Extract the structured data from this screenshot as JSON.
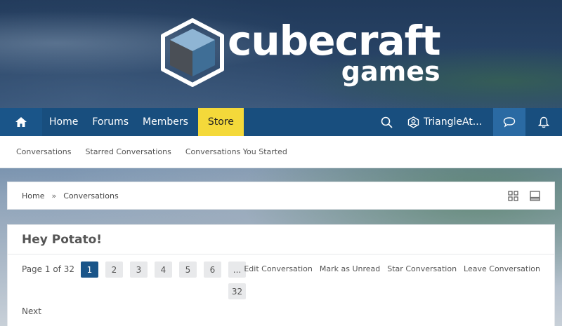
{
  "branding": {
    "logo_main": "cubecraft",
    "logo_sub": "games"
  },
  "nav": {
    "items": [
      {
        "label": "Home"
      },
      {
        "label": "Forums"
      },
      {
        "label": "Members"
      },
      {
        "label": "Store"
      }
    ],
    "username": "TriangleAt...",
    "colors": {
      "bar": "#184e7e",
      "store": "#f4d93a",
      "active_tab": "#2a6aa3"
    }
  },
  "subnav": {
    "items": [
      {
        "label": "Conversations"
      },
      {
        "label": "Starred Conversations"
      },
      {
        "label": "Conversations You Started"
      }
    ]
  },
  "breadcrumb": {
    "items": [
      {
        "label": "Home"
      },
      {
        "label": "Conversations"
      }
    ],
    "separator": "»"
  },
  "conversation": {
    "title": "Hey Potato!",
    "pager": {
      "label": "Page 1 of 32",
      "current": 1,
      "pages": [
        "1",
        "2",
        "3",
        "4",
        "5",
        "6",
        "...",
        "32"
      ],
      "next_label": "Next"
    },
    "actions": [
      {
        "label": "Edit Conversation"
      },
      {
        "label": "Mark as Unread"
      },
      {
        "label": "Star Conversation"
      },
      {
        "label": "Leave Conversation"
      }
    ]
  }
}
